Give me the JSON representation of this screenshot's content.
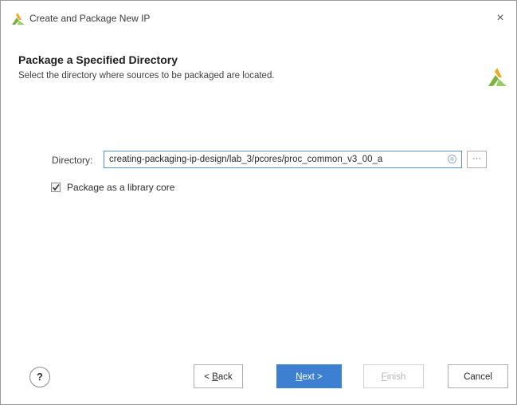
{
  "window": {
    "title": "Create and Package New IP",
    "close_symbol": "×",
    "logo_icon": "vivado-logo-icon"
  },
  "header": {
    "title": "Package a Specified Directory",
    "subtitle": "Select the directory where sources to be packaged are located."
  },
  "form": {
    "directory_label": "Directory:",
    "directory_value": "creating-packaging-ip-design/lab_3/pcores/proc_common_v3_00_a",
    "browse_label": "···",
    "package_library_core_label": "Package as a library core",
    "package_library_core_checked": true
  },
  "footer": {
    "help_label": "?",
    "back_prefix": "< ",
    "back_mnemonic": "B",
    "back_rest": "ack",
    "next_mnemonic": "N",
    "next_rest": "ext >",
    "finish_mnemonic": "F",
    "finish_rest": "inish",
    "cancel_label": "Cancel"
  },
  "colors": {
    "accent": "#3d7fd1",
    "logo_green": "#7cb342",
    "logo_orange": "#f5a623"
  }
}
